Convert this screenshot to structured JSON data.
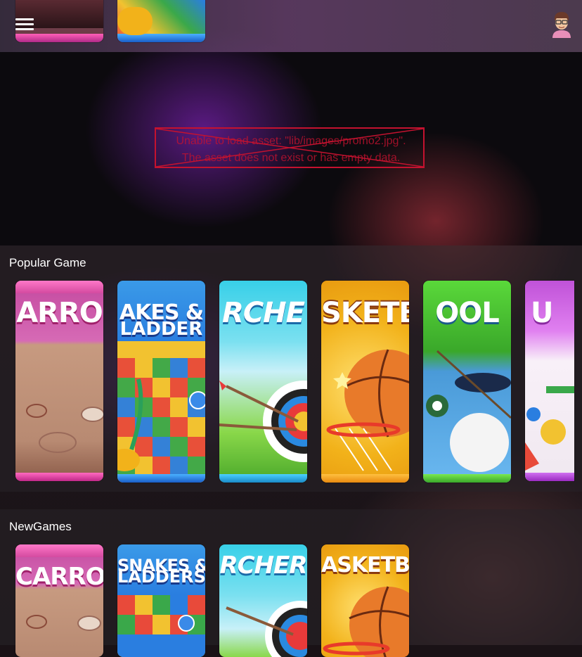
{
  "header": {
    "menu_icon": "hamburger-menu-icon",
    "avatar_icon": "user-avatar-icon"
  },
  "promo": {
    "error_line1": "Unable to load asset: \"lib/images/promo2.jpg\".",
    "error_line2": "The asset does not exist or has empty data."
  },
  "popular": {
    "title": "Popular Game",
    "games": [
      {
        "label": "ARRO",
        "sub": "",
        "theme": "carrom"
      },
      {
        "label": "AKES &",
        "sub": "LADDER",
        "theme": "snakes"
      },
      {
        "label": "RCHE",
        "sub": "",
        "theme": "archery"
      },
      {
        "label": "SKETB",
        "sub": "",
        "theme": "basketball"
      },
      {
        "label": "OOL",
        "sub": "",
        "theme": "pool"
      },
      {
        "label": "U",
        "sub": "",
        "theme": "ludo"
      }
    ]
  },
  "new_games": {
    "title": "NewGames",
    "games": [
      {
        "label": "CARROM",
        "sub": "",
        "theme": "carrom"
      },
      {
        "label": "SNAKES &",
        "sub": "LADDERS",
        "theme": "snakes"
      },
      {
        "label": "RCHER",
        "sub": "",
        "theme": "archery"
      },
      {
        "label": "ASKETBA",
        "sub": "",
        "theme": "basketball"
      }
    ]
  },
  "colors": {
    "error": "#c4122f",
    "carrom": "#d94fa0",
    "snakes": "#2a7ee0",
    "archery": "#38b7e6",
    "basketball": "#f2b21a",
    "pool": "#58c83a",
    "ludo": "#c052d8"
  }
}
